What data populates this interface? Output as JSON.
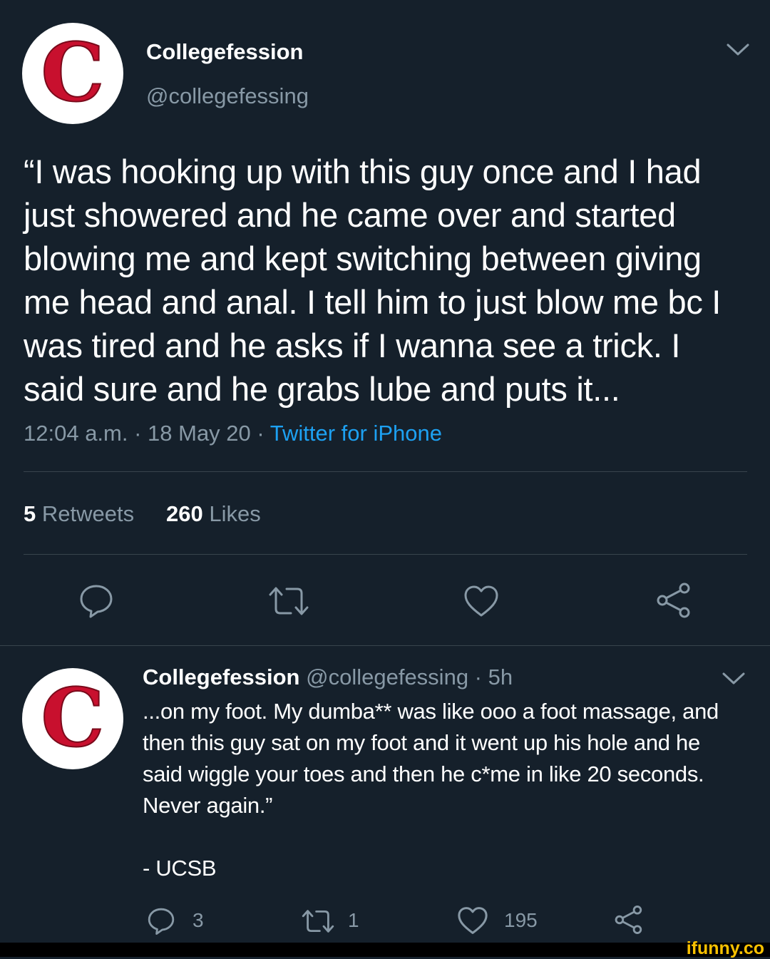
{
  "tweet": {
    "display_name": "Collegefession",
    "handle": "@collegefessing",
    "avatar_letter": "C",
    "text": "“I was hooking up with this guy once and I had just showered and he came over and started blowing me and kept switching between giving me head and anal. I tell him to just blow me bc I was tired and he asks if I wanna see a trick. I said sure and he grabs lube and puts it...",
    "time": "12:04 a.m. · 18 May 20 · ",
    "source": "Twitter for iPhone",
    "retweets_count": "5",
    "retweets_label": "Retweets",
    "likes_count": "260",
    "likes_label": "Likes"
  },
  "reply": {
    "display_name": "Collegefession",
    "handle": "@collegefessing · 5h",
    "avatar_letter": "C",
    "text": "...on my foot. My dumba** was like ooo a foot massage, and then this guy sat on my foot and it went up his hole and he said wiggle your toes and then he c*me in like 20 seconds. Never again.”",
    "signature": "- UCSB",
    "reply_count": "3",
    "retweet_count": "1",
    "like_count": "195"
  },
  "watermark": "ifunny.co",
  "colors": {
    "background": "#15202b",
    "muted": "#8899a6",
    "link": "#1da1f2",
    "divider": "#38444d",
    "logo_red": "#c8102e",
    "watermark": "#f8c100"
  },
  "icons": [
    "chevron-down-icon",
    "reply-icon",
    "retweet-icon",
    "heart-icon",
    "share-icon"
  ]
}
